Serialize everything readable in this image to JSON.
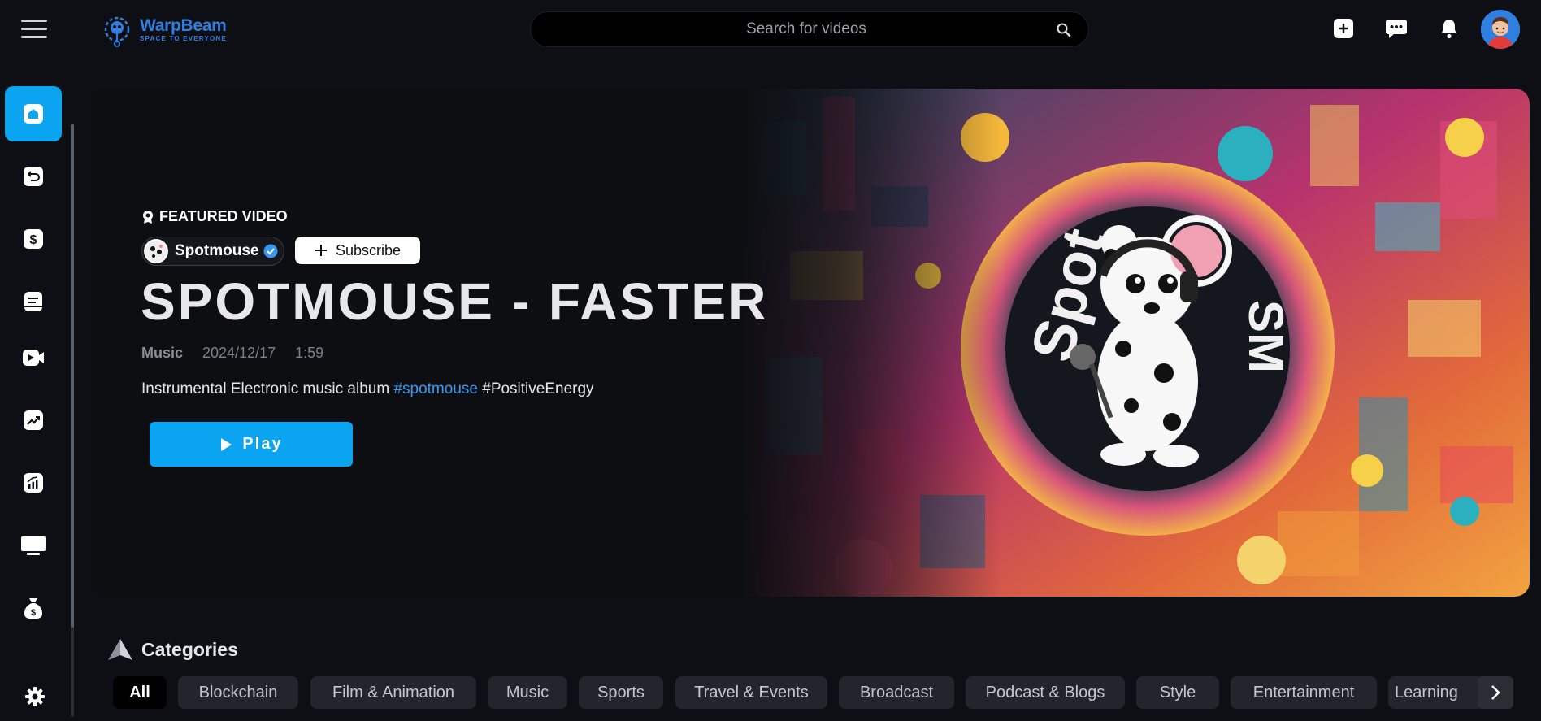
{
  "brand": {
    "name": "WarpBeam",
    "tagline": "SPACE TO EVERYONE"
  },
  "search": {
    "placeholder": "Search for videos"
  },
  "header": {
    "icons": [
      "plus-square-icon",
      "chat-bubble-icon",
      "bell-icon"
    ],
    "avatar": "user-avatar"
  },
  "sidebar": {
    "items": [
      {
        "icon": "home-icon",
        "active": true
      },
      {
        "icon": "history-icon"
      },
      {
        "icon": "dollar-icon"
      },
      {
        "icon": "document-icon"
      },
      {
        "icon": "video-icon"
      },
      {
        "icon": "trending-icon"
      },
      {
        "icon": "analytics-icon"
      },
      {
        "icon": "monitor-icon"
      },
      {
        "icon": "money-bag-icon"
      }
    ],
    "footer_icon": "gear-icon"
  },
  "featured": {
    "badge": "FEATURED VIDEO",
    "channel": "Spotmouse",
    "subscribe_label": "Subscribe",
    "title": "SPOTMOUSE - FASTER",
    "category": "Music",
    "date": "2024/12/17",
    "duration": "1:59",
    "description": "Instrumental Electronic music album ",
    "hashtags": [
      "#spotmouse",
      "#PositiveEnergy"
    ],
    "play_label": "Play"
  },
  "categories": {
    "title": "Categories",
    "items": [
      "All",
      "Blockchain",
      "Film & Animation",
      "Music",
      "Sports",
      "Travel & Events",
      "Broadcast",
      "Podcast & Blogs",
      "Style",
      "Entertainment",
      "Learning"
    ],
    "active": "All"
  },
  "colors": {
    "accent": "#0aa4f0",
    "brand": "#2f7fe0",
    "hashtag": "#3a97f0"
  }
}
